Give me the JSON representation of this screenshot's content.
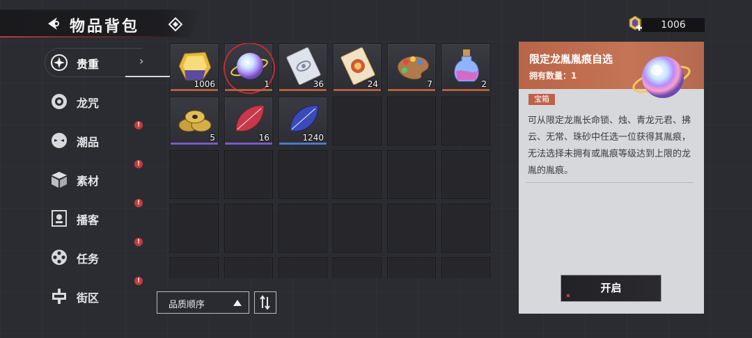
{
  "header": {
    "title": "物品背包",
    "back_icon": "back-arrow-icon",
    "info_icon": "diamond-icon"
  },
  "currency": {
    "icon": "gem-plus-icon",
    "amount": "1006"
  },
  "sidebar": {
    "items": [
      {
        "label": "贵重",
        "icon": "star-burst-icon",
        "active": true,
        "badge": ""
      },
      {
        "label": "龙咒",
        "icon": "ring-icon",
        "active": false,
        "badge": ""
      },
      {
        "label": "潮品",
        "icon": "mask-icon",
        "active": false,
        "badge": "!"
      },
      {
        "label": "素材",
        "icon": "box-icon",
        "active": false,
        "badge": "!"
      },
      {
        "label": "播客",
        "icon": "podcast-icon",
        "active": false,
        "badge": "!"
      },
      {
        "label": "任务",
        "icon": "film-reel-icon",
        "active": false,
        "badge": "!"
      },
      {
        "label": "街区",
        "icon": "district-icon",
        "active": false,
        "badge": "!"
      }
    ]
  },
  "inventory": {
    "items": [
      {
        "name": "gold-crystal",
        "qty": "1006",
        "rarity_color": "#b5613f"
      },
      {
        "name": "rainbow-orb",
        "qty": "1",
        "rarity_color": "#b5613f",
        "selected": true
      },
      {
        "name": "silver-card",
        "qty": "36",
        "rarity_color": "#b5613f"
      },
      {
        "name": "red-gold-card",
        "qty": "24",
        "rarity_color": "#b5613f"
      },
      {
        "name": "paint-palette",
        "qty": "7",
        "rarity_color": "#b5613f"
      },
      {
        "name": "potion-bottle",
        "qty": "2",
        "rarity_color": "#b5613f"
      },
      {
        "name": "gold-coins",
        "qty": "5",
        "rarity_color": "#7b5cc4"
      },
      {
        "name": "red-leaf",
        "qty": "16",
        "rarity_color": "#7b5cc4"
      },
      {
        "name": "blue-leaf",
        "qty": "1240",
        "rarity_color": "#4f79c4"
      }
    ]
  },
  "sort": {
    "label": "品质顺序",
    "order_icon": "sort-order-icon"
  },
  "detail": {
    "name": "限定龙胤胤痕自选",
    "own_label": "拥有数量：",
    "own_count": "1",
    "tag": "宝箱",
    "description": "可从限定龙胤长命锁、烛、青龙元君、拂云、无常、珠砂中任选一位获得其胤痕，无法选择未拥有或胤痕等级达到上限的龙胤的胤痕。",
    "action": "开启",
    "header_color": "#bf6c4e"
  }
}
